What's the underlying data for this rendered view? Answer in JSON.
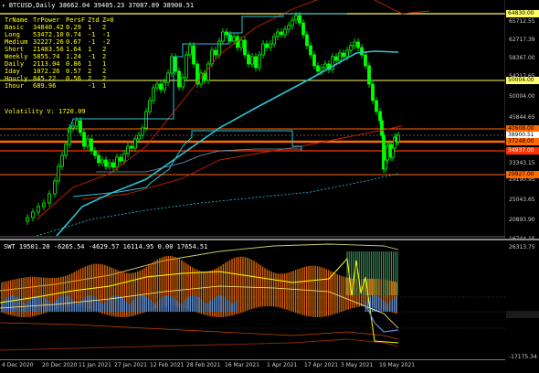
{
  "chart": {
    "header": "BTCUSD,Daily  38662.04 39405.23 37087.89 38900.51",
    "stats": {
      "headers": [
        "TrName",
        "TrPower",
        "PersF",
        "Ztd",
        "Z=0"
      ],
      "rows": [
        [
          "Basic",
          "34840.42",
          "0.29",
          "1",
          "2"
        ],
        [
          "Long",
          "53472.10",
          "0.74",
          "-1",
          "-1"
        ],
        [
          "Medium",
          "32227.26",
          "0.67",
          "-1",
          "-2"
        ],
        [
          "Short",
          "21483.56",
          "1.64",
          "1",
          "2"
        ],
        [
          "Weekly",
          "5855.74",
          "1.24",
          "-1",
          "2"
        ],
        [
          "Daily",
          "2113.04",
          "0.86",
          "1",
          "1"
        ],
        [
          "Iday",
          "1072.26",
          "0.57",
          "2",
          "2"
        ],
        [
          "Hourly",
          "845.22",
          "0.56",
          "2",
          "2"
        ],
        [
          "Ihour",
          "689.96",
          "",
          "-1",
          "1"
        ]
      ],
      "volatility": "Volatility V: 1720.09"
    },
    "price_axis": [
      "65712.55",
      "62717.39",
      "58367.00",
      "54217.65",
      "50004.00",
      "45844.65",
      "41768.60",
      "33343.15",
      "29190.95",
      "25043.65",
      "20893.90",
      "16744.15"
    ],
    "price_tags": [
      {
        "text": "64830.00",
        "bg": "#ffff66",
        "fg": "#000000"
      },
      {
        "text": "50004.00",
        "bg": "#ffff66",
        "fg": "#000000"
      },
      {
        "text": "40608.00",
        "bg": "#ff6a00",
        "fg": "#000000"
      },
      {
        "text": "38900.51",
        "bg": "#ffffff",
        "fg": "#000000"
      },
      {
        "text": "37248.00",
        "bg": "#ff6a00",
        "fg": "#000000"
      },
      {
        "text": "34937.00",
        "bg": "#ff3300",
        "fg": "#ffffff"
      },
      {
        "text": "29927.00",
        "bg": "#ff6a00",
        "fg": "#000000"
      }
    ]
  },
  "indicator": {
    "header": "SWT 19501.20 -6265.54 -4629.57 16114.95 0.00 17654.51",
    "axis": [
      "26313.75",
      "0.00",
      "-17175.34"
    ]
  },
  "time_axis": [
    "4 Dec 2020",
    "20 Dec 2020",
    "11 Jan 2021",
    "27 Jan 2021",
    "12 Feb 2021",
    "28 Feb 2021",
    "16 Mar 2021",
    "1 Apr 2021",
    "17 Apr 2021",
    "3 May 2021",
    "19 May 2021"
  ],
  "colors": {
    "candle": "#00ff00",
    "level_orange": "#ff6a00",
    "level_yellow": "#ffff66",
    "ma_cyan": "#2bc3d6",
    "ma_red": "#cc2200",
    "hist_orange": "#ff7700",
    "hist_blue": "#5b8fd6"
  }
}
